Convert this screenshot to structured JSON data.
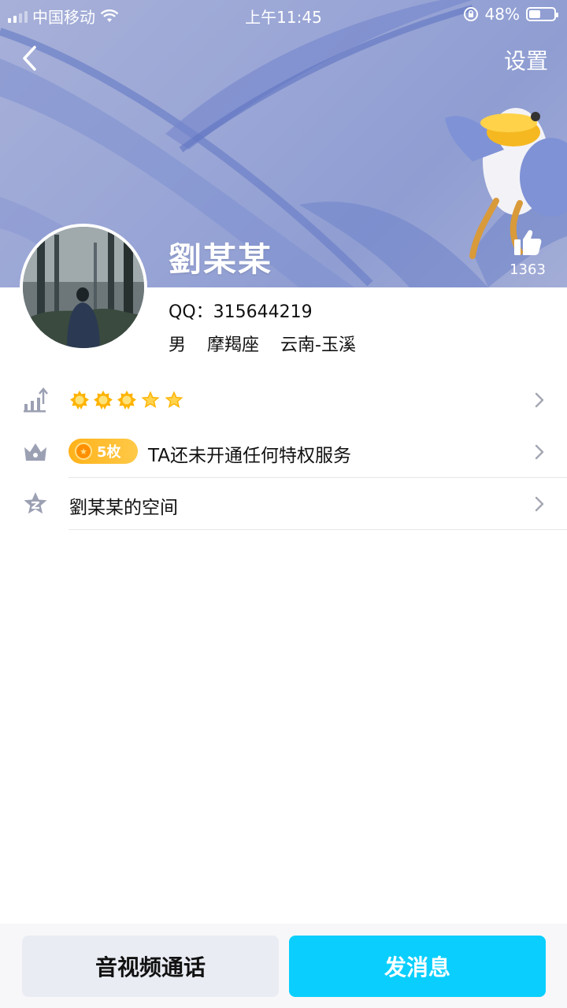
{
  "status_bar": {
    "carrier": "中国移动",
    "time": "上午11:45",
    "battery": "48%",
    "battery_level": 0.48
  },
  "header": {
    "settings_label": "设置",
    "back_icon": "chevron-left-icon"
  },
  "profile": {
    "name": "劉某某",
    "qq_label": "QQ：315644219",
    "gender": "男",
    "zodiac": "摩羯座",
    "location": "云南-玉溪",
    "likes": "1363",
    "like_icon": "thumbs-up-icon"
  },
  "list": {
    "level": {
      "icon": "level-chart-icon",
      "stars": 5,
      "sun_icons": 3,
      "star_icons": 2
    },
    "privilege": {
      "icon": "crown-icon",
      "badge_label": "5枚",
      "text": "TA还未开通任何特权服务"
    },
    "qzone": {
      "icon": "qzone-star-icon",
      "text": "劉某某的空间"
    }
  },
  "bottom": {
    "call_label": "音视频通话",
    "message_label": "发消息"
  },
  "colors": {
    "accent": "#0acffe",
    "banner": "#9aa6d6",
    "badge": "#ffb21a"
  }
}
